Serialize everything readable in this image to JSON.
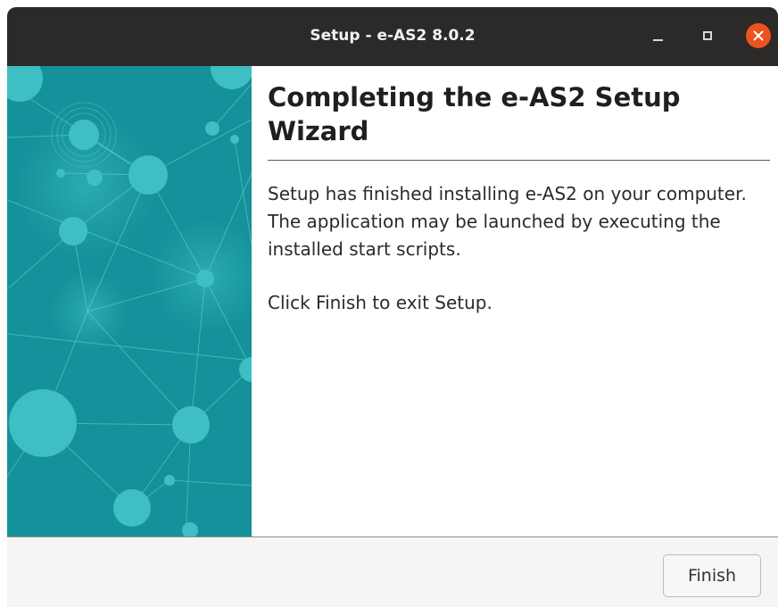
{
  "window": {
    "title": "Setup - e-AS2 8.0.2",
    "controls": {
      "minimize_icon": "minimize-icon",
      "maximize_icon": "maximize-icon",
      "close_icon": "close-icon"
    }
  },
  "wizard": {
    "heading": "Completing the e-AS2 Setup Wizard",
    "body": "Setup has finished installing e-AS2 on your computer. The application may be launched by executing the installed start scripts.",
    "exit_instruction": "Click Finish to exit Setup."
  },
  "footer": {
    "finish_label": "Finish"
  },
  "colors": {
    "titlebar": "#2c2a28",
    "close_button": "#e9541f",
    "banner": "#14919a",
    "banner_nodes": "#3dbfc4"
  }
}
